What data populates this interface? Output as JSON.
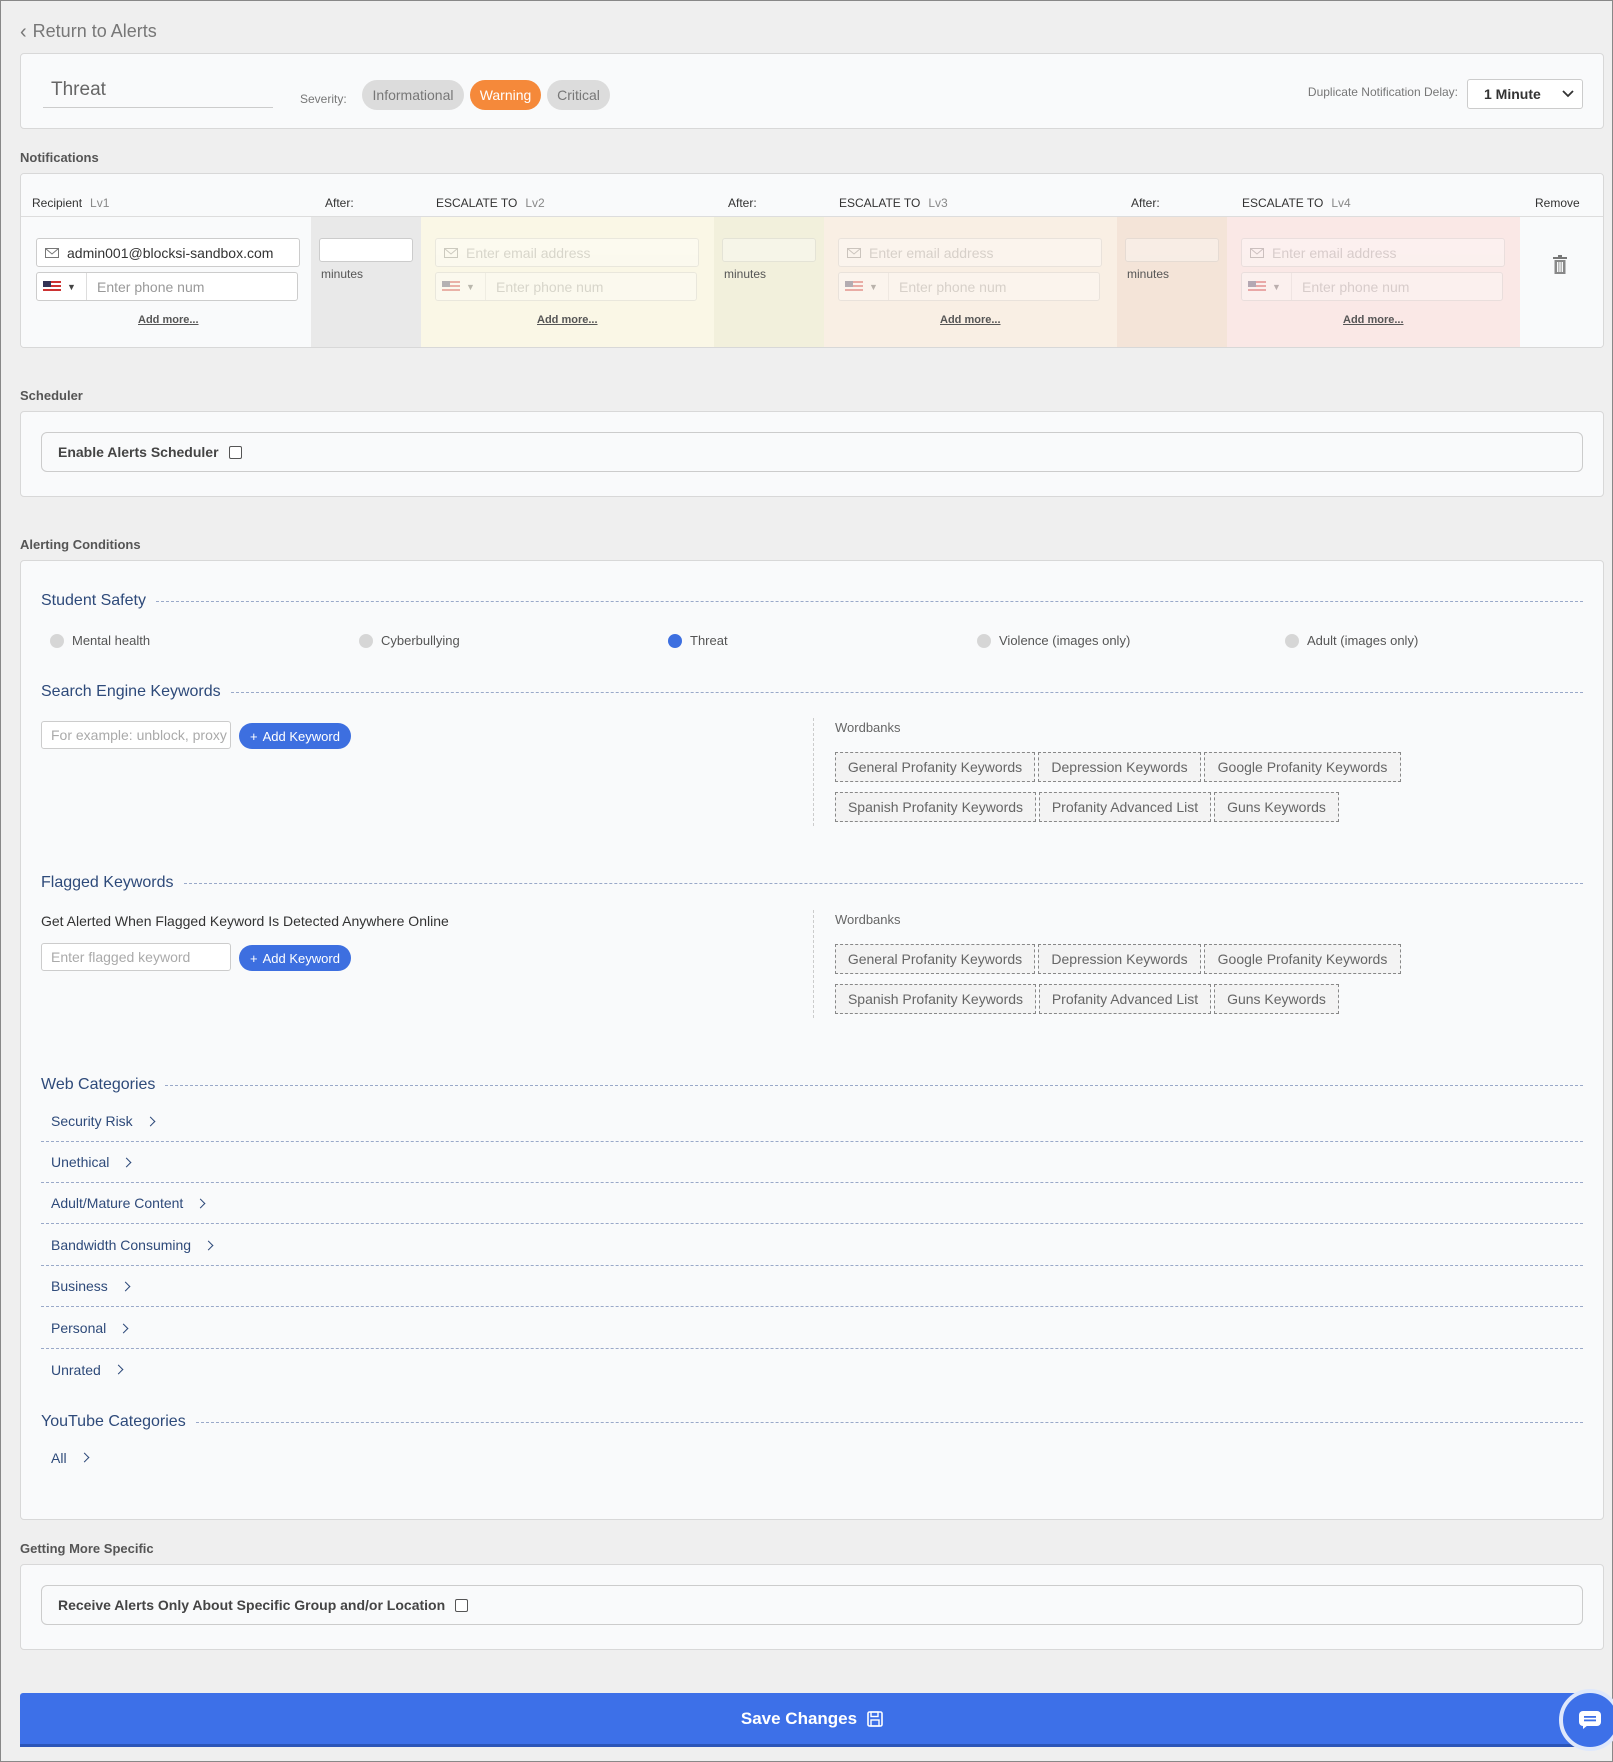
{
  "back_link": "Return to Alerts",
  "alert": {
    "name": "Threat",
    "severity_label": "Severity:",
    "severities": [
      "Informational",
      "Warning",
      "Critical"
    ],
    "selected_severity": "Warning",
    "dup_delay_label": "Duplicate Notification Delay:",
    "dup_delay_value": "1 Minute"
  },
  "notifications": {
    "section_label": "Notifications",
    "headers": {
      "recipient": "Recipient",
      "lv1": "Lv1",
      "after": "After:",
      "escalate": "ESCALATE TO",
      "lv2": "Lv2",
      "lv3": "Lv3",
      "lv4": "Lv4",
      "remove": "Remove"
    },
    "recipient_email": "admin001@blocksi-sandbox.com",
    "email_placeholder": "Enter email address",
    "phone_placeholder": "Enter phone num",
    "minutes_label": "minutes",
    "add_more": "Add more..."
  },
  "scheduler": {
    "section_label": "Scheduler",
    "enable_label": "Enable Alerts Scheduler",
    "enabled": false
  },
  "conditions": {
    "section_label": "Alerting Conditions",
    "student_safety": {
      "title": "Student Safety",
      "options": [
        "Mental health",
        "Cyberbullying",
        "Threat",
        "Violence (images only)",
        "Adult (images only)"
      ],
      "selected": "Threat"
    },
    "search_keywords": {
      "title": "Search Engine Keywords",
      "placeholder": "For example: unblock, proxy",
      "add_label": "Add Keyword",
      "wordbanks_label": "Wordbanks",
      "wordbanks": [
        "General Profanity Keywords",
        "Depression Keywords",
        "Google Profanity Keywords",
        "Spanish Profanity Keywords",
        "Profanity Advanced List",
        "Guns Keywords"
      ]
    },
    "flagged_keywords": {
      "title": "Flagged Keywords",
      "description": "Get Alerted When Flagged Keyword Is Detected Anywhere Online",
      "placeholder": "Enter flagged keyword",
      "add_label": "Add Keyword",
      "wordbanks_label": "Wordbanks",
      "wordbanks": [
        "General Profanity Keywords",
        "Depression Keywords",
        "Google Profanity Keywords",
        "Spanish Profanity Keywords",
        "Profanity Advanced List",
        "Guns Keywords"
      ]
    },
    "web_categories": {
      "title": "Web Categories",
      "items": [
        "Security Risk",
        "Unethical",
        "Adult/Mature Content",
        "Bandwidth Consuming",
        "Business",
        "Personal",
        "Unrated"
      ]
    },
    "youtube_categories": {
      "title": "YouTube Categories",
      "items": [
        "All"
      ]
    }
  },
  "specific": {
    "section_label": "Getting More Specific",
    "receive_label": "Receive Alerts Only About Specific Group and/or Location",
    "enabled": false
  },
  "save_label": "Save Changes",
  "colors": {
    "accent": "#3d70e8",
    "warning": "#f5893a",
    "link": "#2e4a7a"
  }
}
